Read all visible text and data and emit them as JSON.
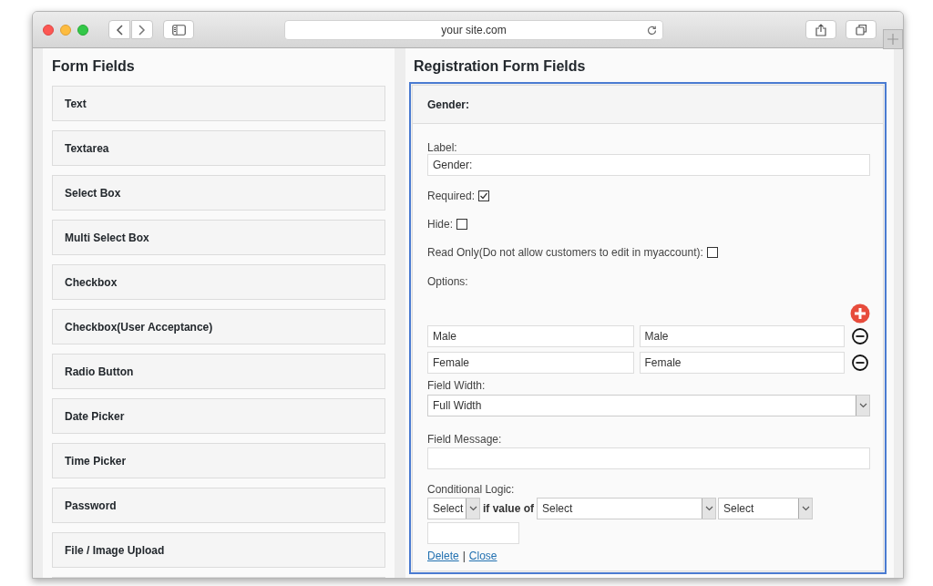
{
  "browser": {
    "url": "your site.com"
  },
  "form_fields": {
    "title": "Form Fields",
    "items": [
      "Text",
      "Textarea",
      "Select Box",
      "Multi Select Box",
      "Checkbox",
      "Checkbox(User Acceptance)",
      "Radio Button",
      "Date Picker",
      "Time Picker",
      "Password",
      "File / Image Upload"
    ]
  },
  "registration": {
    "title": "Registration Form Fields",
    "field": {
      "header": "Gender:",
      "label_caption": "Label:",
      "label_value": "Gender:",
      "checks": [
        {
          "label": "Required:",
          "checked": true
        },
        {
          "label": "Hide:",
          "checked": false
        },
        {
          "label": "Read Only(Do not allow customers to edit in myaccount):",
          "checked": false
        }
      ],
      "options_caption": "Options:",
      "options": [
        {
          "label": "Male",
          "value": "Male"
        },
        {
          "label": "Female",
          "value": "Female"
        }
      ],
      "width_caption": "Field Width:",
      "width_value": "Full Width",
      "message_caption": "Field Message:",
      "logic_caption": "Conditional Logic:",
      "logic": {
        "action": "Select",
        "connector": "if value of",
        "field": "Select",
        "operator": "Select"
      },
      "links": [
        "Delete",
        "Close"
      ],
      "separator": "|"
    }
  }
}
